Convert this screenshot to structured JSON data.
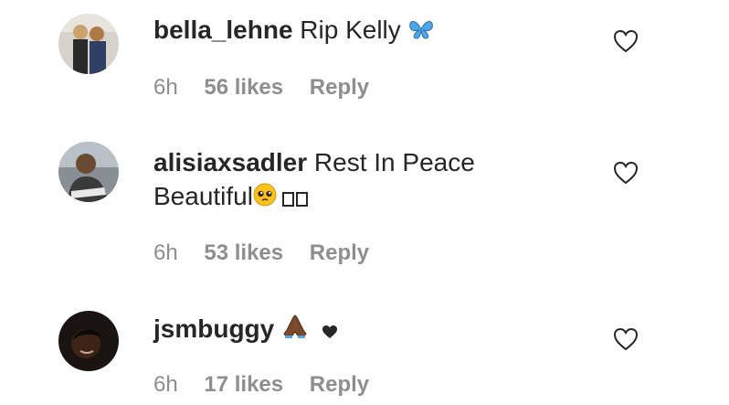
{
  "comments": [
    {
      "username": "bella_lehne",
      "text": "Rip Kelly",
      "emoji": "blue-butterfly-icon",
      "time": "6h",
      "likes": "56 likes",
      "reply": "Reply"
    },
    {
      "username": "alisiaxsadler",
      "text": "Rest In Peace",
      "text_line2": "Beautiful",
      "emoji": "pleading-face-icon",
      "time": "6h",
      "likes": "53 likes",
      "reply": "Reply"
    },
    {
      "username": "jsmbuggy",
      "text": "",
      "emoji": "folded-hands-icon",
      "emoji2": "black-heart-icon",
      "time": "6h",
      "likes": "17 likes",
      "reply": "Reply"
    }
  ],
  "colors": {
    "text": "#262626",
    "meta": "#8e8e8e",
    "butterfly": "#4fa6e6"
  }
}
